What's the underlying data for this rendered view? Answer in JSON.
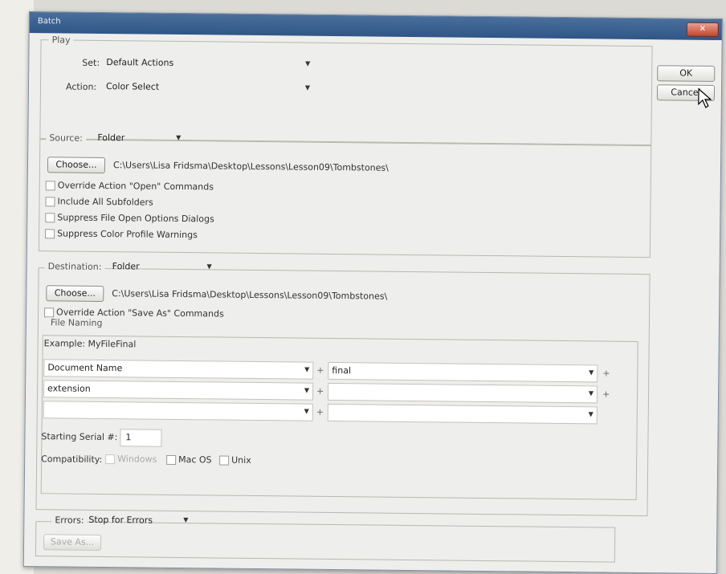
{
  "window": {
    "title": "Batch",
    "close_icon": "close-icon"
  },
  "buttons": {
    "ok": "OK",
    "cancel": "Cancel"
  },
  "play": {
    "legend": "Play",
    "set_label": "Set:",
    "set_value": "Default Actions",
    "action_label": "Action:",
    "action_value": "Color Select"
  },
  "source": {
    "label": "Source:",
    "value": "Folder",
    "choose": "Choose...",
    "path": "C:\\Users\\Lisa Fridsma\\Desktop\\Lessons\\Lesson09\\Tombstones\\",
    "options": [
      "Override Action \"Open\" Commands",
      "Include All Subfolders",
      "Suppress File Open Options Dialogs",
      "Suppress Color Profile Warnings"
    ]
  },
  "destination": {
    "label": "Destination:",
    "value": "Folder",
    "choose": "Choose...",
    "path": "C:\\Users\\Lisa Fridsma\\Desktop\\Lessons\\Lesson09\\Tombstones\\",
    "override": "Override Action \"Save As\" Commands"
  },
  "file_naming": {
    "legend": "File Naming",
    "example": "Example: MyFileFinal",
    "rows": [
      {
        "left": "Document Name",
        "right": "final"
      },
      {
        "left": "extension",
        "right": ""
      },
      {
        "left": "",
        "right": ""
      }
    ],
    "plus": "+",
    "serial_label": "Starting Serial #:",
    "serial_value": "1",
    "compat_label": "Compatibility:",
    "compat_windows": "Windows",
    "compat_mac": "Mac OS",
    "compat_unix": "Unix"
  },
  "errors": {
    "label": "Errors:",
    "value": "Stop for Errors",
    "save_as": "Save As..."
  }
}
